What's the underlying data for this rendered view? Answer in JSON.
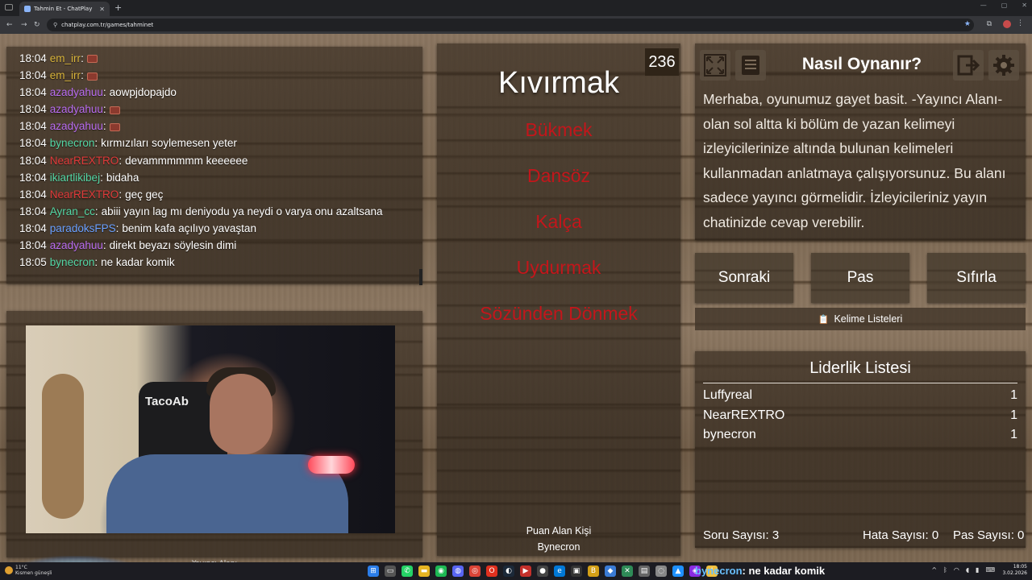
{
  "browser": {
    "tab_title": "Tahmin Et - ChatPlay",
    "url": "chatplay.com.tr/games/tahminet"
  },
  "chat": {
    "messages": [
      {
        "time": "18:04",
        "user": "em_irr",
        "color": "#d7b33a",
        "text": "",
        "emote": true
      },
      {
        "time": "18:04",
        "user": "em_irr",
        "color": "#d7b33a",
        "text": "",
        "emote": true
      },
      {
        "time": "18:04",
        "user": "azadyahuu",
        "color": "#b86cf0",
        "text": "aowpjdopajdo",
        "emote": false
      },
      {
        "time": "18:04",
        "user": "azadyahuu",
        "color": "#b86cf0",
        "text": "",
        "emote": true
      },
      {
        "time": "18:04",
        "user": "azadyahuu",
        "color": "#b86cf0",
        "text": "",
        "emote": true
      },
      {
        "time": "18:04",
        "user": "bynecron",
        "color": "#54d7a6",
        "text": "kırmızıları soylemesen yeter",
        "emote": false
      },
      {
        "time": "18:04",
        "user": "NearREXTRO",
        "color": "#e03a3a",
        "text": "devammmmmm keeeeee",
        "emote": false
      },
      {
        "time": "18:04",
        "user": "ikiartlikibej",
        "color": "#54d7a6",
        "text": "bidaha",
        "emote": false
      },
      {
        "time": "18:04",
        "user": "NearREXTRO",
        "color": "#e03a3a",
        "text": "geç geç",
        "emote": false
      },
      {
        "time": "18:04",
        "user": "Ayran_cc",
        "color": "#54d7a6",
        "text": "abiii yayın lag mı deniyodu ya neydi o varya onu azaltsana",
        "emote": false
      },
      {
        "time": "18:04",
        "user": "paradoksFPS",
        "color": "#6aa0ff",
        "text": "benim kafa açılıyo yavaştan",
        "emote": false
      },
      {
        "time": "18:04",
        "user": "azadyahuu",
        "color": "#b86cf0",
        "text": "direkt beyazı söylesin dimi",
        "emote": false
      },
      {
        "time": "18:05",
        "user": "bynecron",
        "color": "#54d7a6",
        "text": "ne kadar komik",
        "emote": false
      }
    ]
  },
  "webcam": {
    "chair_text": "TacoAb",
    "caption": "Yayıncı Alanı"
  },
  "game": {
    "timer": "236",
    "main_word": "Kıvırmak",
    "forbidden_words": [
      "Bükmek",
      "Dansöz",
      "Kalça",
      "Uydurmak",
      "Sözünden Dönmek"
    ],
    "scorer_label": "Puan Alan Kişi",
    "scorer_name": "Bynecron"
  },
  "howto": {
    "title": "Nasıl Oynanır?",
    "text": "Merhaba, oyunumuz gayet basit. -Yayıncı Alanı- olan sol altta ki bölüm de yazan kelimeyi izleyicilerinize altında bulunan kelimeleri kullanmadan anlatmaya çalışıyorsunuz. Bu alanı sadece yayıncı görmelidir. İzleyicileriniz yayın chatinizde cevap verebilir."
  },
  "actions": {
    "next": "Sonraki",
    "pass": "Pas",
    "reset": "Sıfırla",
    "word_lists": "Kelime Listeleri"
  },
  "leaderboard": {
    "title": "Liderlik Listesi",
    "rows": [
      {
        "name": "Luffyreal",
        "score": "1"
      },
      {
        "name": "NearREXTRO",
        "score": "1"
      },
      {
        "name": "bynecron",
        "score": "1"
      }
    ],
    "question_count": "Soru Sayısı: 3",
    "error_count": "Hata Sayısı: 0",
    "pass_count": "Pas Sayısı: 0"
  },
  "taskbar": {
    "weather_temp": "11°C",
    "weather_desc": "Kısmen güneşli",
    "now_playing_user": "bynecron",
    "now_playing_text": ": ne kadar komik",
    "time": "18:05",
    "date": "3.02.2026"
  },
  "colors": {
    "forbidden": "#c3161b",
    "accent": "#8ab4f8"
  }
}
